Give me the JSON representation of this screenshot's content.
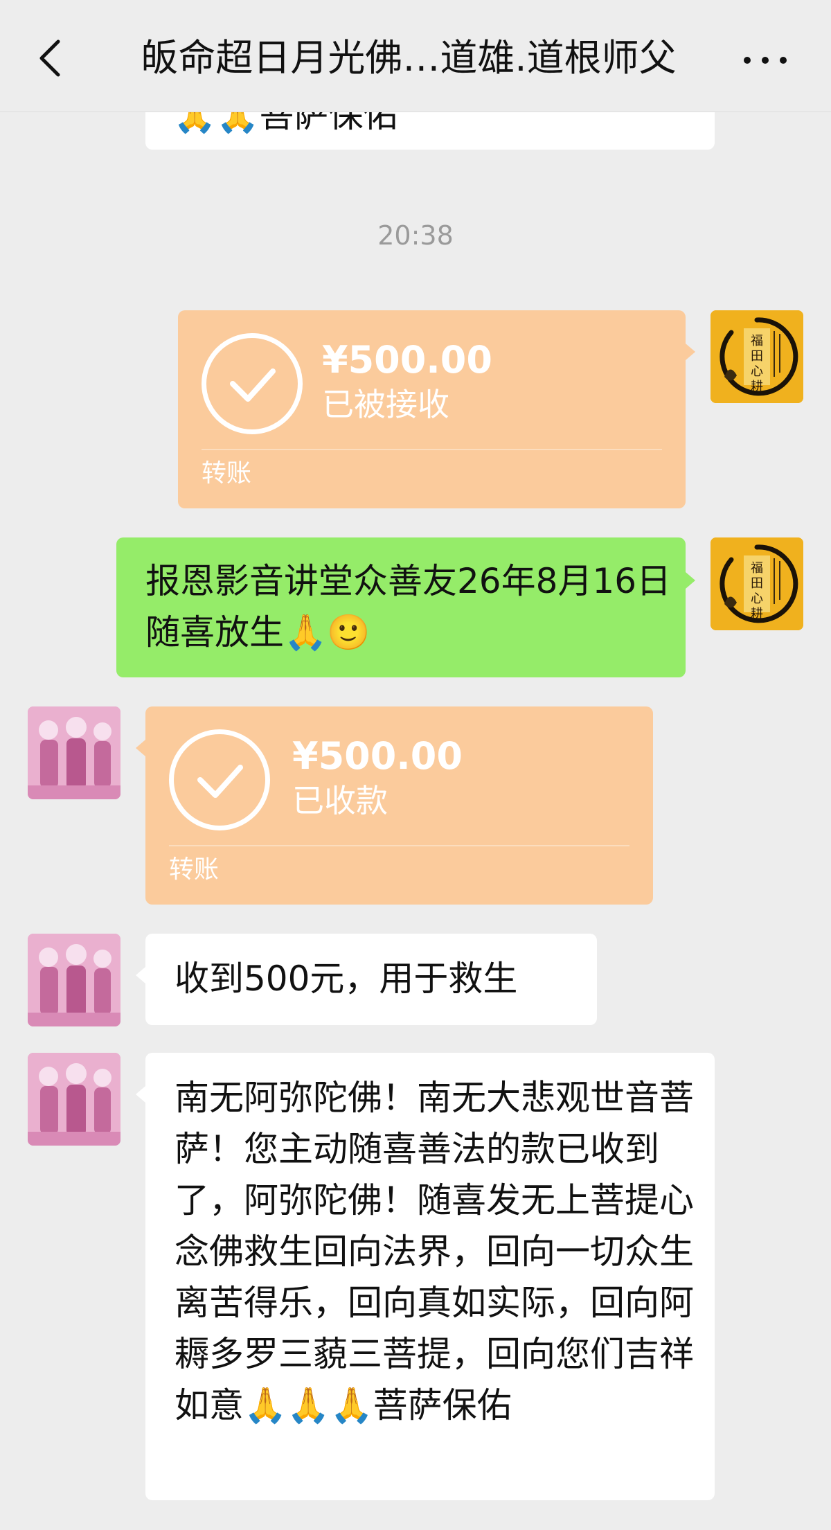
{
  "header": {
    "title": "皈命超日月光佛…道雄.道根师父"
  },
  "partial_top_message": {
    "text": "🙏🙏菩萨保佑"
  },
  "timestamp": "20:38",
  "messages": {
    "transfer_sent": {
      "amount": "¥500.00",
      "status": "已被接收",
      "label": "转账"
    },
    "text_sent": {
      "text": "报恩影音讲堂众善友26年8月16日随喜放生🙏🙂"
    },
    "transfer_received": {
      "amount": "¥500.00",
      "status": "已收款",
      "label": "转账"
    },
    "text_received_1": {
      "text": "收到500元，用于救生"
    },
    "text_received_2": {
      "text": "南无阿弥陀佛！南无大悲观世音菩萨！您主动随喜善法的款已收到了，阿弥陀佛！随喜发无上菩提心念佛救生回向法界，回向一切众生离苦得乐，回向真如实际，回向阿耨多罗三藐三菩提，回向您们吉祥如意🙏🙏🙏菩萨保佑"
    }
  },
  "avatars": {
    "self": {
      "name": "福田心耕",
      "icon": "lotus-calligraphy-avatar"
    },
    "other": {
      "icon": "buddha-statues-avatar"
    }
  },
  "colors": {
    "background": "#ededed",
    "bubble_sent_text": "#95ec69",
    "bubble_received_text": "#ffffff",
    "transfer_card": "#fbcb9c"
  }
}
